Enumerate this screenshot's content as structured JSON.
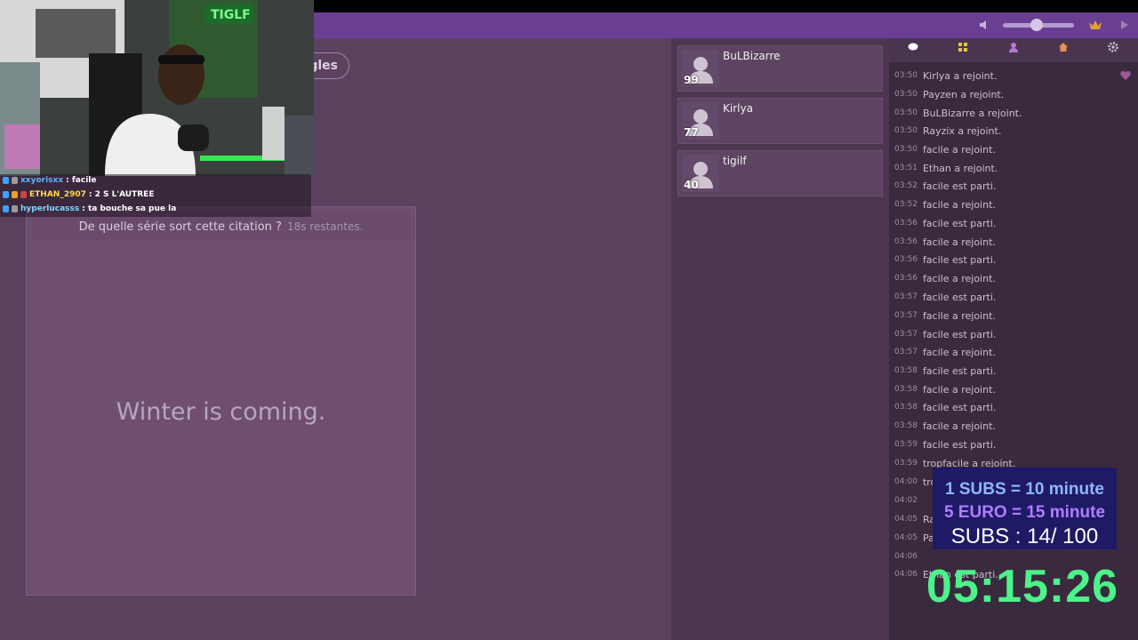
{
  "header": {
    "rules_label": "Règles"
  },
  "question": {
    "prompt": "De quelle série sort cette citation ?",
    "timer": "18s restantes.",
    "quote": "Winter is coming."
  },
  "players": [
    {
      "name": "BuLBizarre",
      "score": "99"
    },
    {
      "name": "Kirlya",
      "score": "77"
    },
    {
      "name": "tigilf",
      "score": "40"
    }
  ],
  "chat_log": [
    {
      "time": "03:50",
      "msg": "Kirlya a rejoint."
    },
    {
      "time": "03:50",
      "msg": "Payzen a rejoint."
    },
    {
      "time": "03:50",
      "msg": "BuLBizarre a rejoint."
    },
    {
      "time": "03:50",
      "msg": "Rayzix a rejoint."
    },
    {
      "time": "03:50",
      "msg": "facile a rejoint."
    },
    {
      "time": "03:51",
      "msg": "Ethan a rejoint."
    },
    {
      "time": "03:52",
      "msg": "facile est parti."
    },
    {
      "time": "03:52",
      "msg": "facile a rejoint."
    },
    {
      "time": "03:56",
      "msg": "facile est parti."
    },
    {
      "time": "03:56",
      "msg": "facile a rejoint."
    },
    {
      "time": "03:56",
      "msg": "facile est parti."
    },
    {
      "time": "03:56",
      "msg": "facile a rejoint."
    },
    {
      "time": "03:57",
      "msg": "facile est parti."
    },
    {
      "time": "03:57",
      "msg": "facile a rejoint."
    },
    {
      "time": "03:57",
      "msg": "facile est parti."
    },
    {
      "time": "03:57",
      "msg": "facile a rejoint."
    },
    {
      "time": "03:58",
      "msg": "facile est parti."
    },
    {
      "time": "03:58",
      "msg": "facile a rejoint."
    },
    {
      "time": "03:58",
      "msg": "facile est parti."
    },
    {
      "time": "03:58",
      "msg": "facile a rejoint."
    },
    {
      "time": "03:59",
      "msg": "facile est parti."
    },
    {
      "time": "03:59",
      "msg": "tropfacile a rejoint."
    },
    {
      "time": "04:00",
      "msg": "trop"
    },
    {
      "time": "04:02",
      "msg": ""
    },
    {
      "time": "04:05",
      "msg": "Ray"
    },
    {
      "time": "04:05",
      "msg": "Pay"
    },
    {
      "time": "04:06",
      "msg": ""
    },
    {
      "time": "04:06",
      "msg": "Ethan est parti."
    }
  ],
  "twitch_chat": [
    {
      "user": "xxyorisxx",
      "msg": ": facile",
      "color": "#5fb3ff"
    },
    {
      "user": "ETHAN_2907",
      "msg": ": 2 S L'AUTREE",
      "color": "#ffd84a"
    },
    {
      "user": "hyperlucasss",
      "msg": ": ta bouche sa pue la",
      "color": "#7fd2ff"
    }
  ],
  "overlay": {
    "subs_rate": "1 SUBS = 10 minute",
    "euro_rate": "5 EURO = 15 minute",
    "subs_count": "SUBS : 14/ 100",
    "timer": "05:15:26"
  },
  "colors": {
    "header": "#6a3f92",
    "timer": "#4cf28a"
  }
}
